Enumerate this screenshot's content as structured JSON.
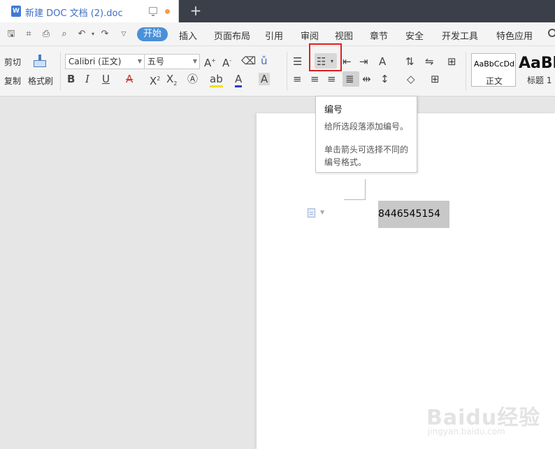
{
  "titlebar": {
    "tab_title": "新建 DOC 文档 (2).doc",
    "doc_icon_letter": "W",
    "new_tab_symbol": "+"
  },
  "menubar": {
    "items": [
      "开始",
      "插入",
      "页面布局",
      "引用",
      "审阅",
      "视图",
      "章节",
      "安全",
      "开发工具",
      "特色应用"
    ],
    "active": "开始",
    "accent_color": "#4a90d9"
  },
  "ribbon": {
    "cut_label": "剪切",
    "copy_label": "复制",
    "format_painter_label": "格式刷",
    "font_name": "Calibri (正文)",
    "font_size": "五号",
    "styles": [
      {
        "sample": "AaBbCcDd",
        "label": "正文"
      },
      {
        "sample": "AaBb",
        "label": "标题 1"
      }
    ]
  },
  "tooltip": {
    "title": "编号",
    "line1": "给所选段落添加编号。",
    "line2": "单击箭头可选择不同的",
    "line3": "编号格式。"
  },
  "document": {
    "selected_text": "8446545154"
  },
  "watermark": {
    "text": "Baidu经验",
    "url": "jingyan.baidu.com"
  },
  "colors": {
    "highlight_border": "#e02020",
    "tab_title": "#3e6fc4",
    "titlebar_bg": "#3a3f4a"
  }
}
